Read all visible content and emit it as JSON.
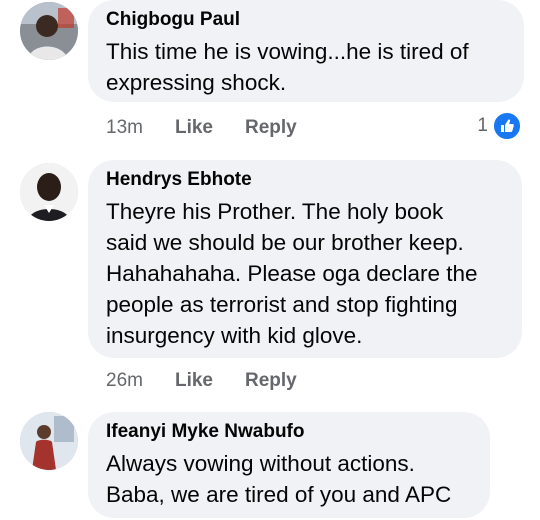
{
  "comments": [
    {
      "author": "Chigbogu Paul",
      "lines": [
        "This time he is vowing...he is tired of",
        "expressing shock."
      ],
      "time": "13m",
      "like_label": "Like",
      "reply_label": "Reply",
      "reaction_count": "1",
      "reaction_icon": "like-thumb-icon"
    },
    {
      "author": "Hendrys Ebhote",
      "lines": [
        "Theyre his Prother. The holy book",
        "said we should be our brother keep.",
        "Hahahahaha. Please oga declare the",
        "people as terrorist and stop fighting",
        "insurgency with kid glove."
      ],
      "time": "26m",
      "like_label": "Like",
      "reply_label": "Reply"
    },
    {
      "author": "Ifeanyi Myke Nwabufo",
      "lines": [
        "Always vowing without actions.",
        "Baba, we are tired of you and APC"
      ]
    }
  ],
  "colors": {
    "bubble": "#f0f2f5",
    "meta_text": "#65676b",
    "like_blue": "#1877f2"
  }
}
